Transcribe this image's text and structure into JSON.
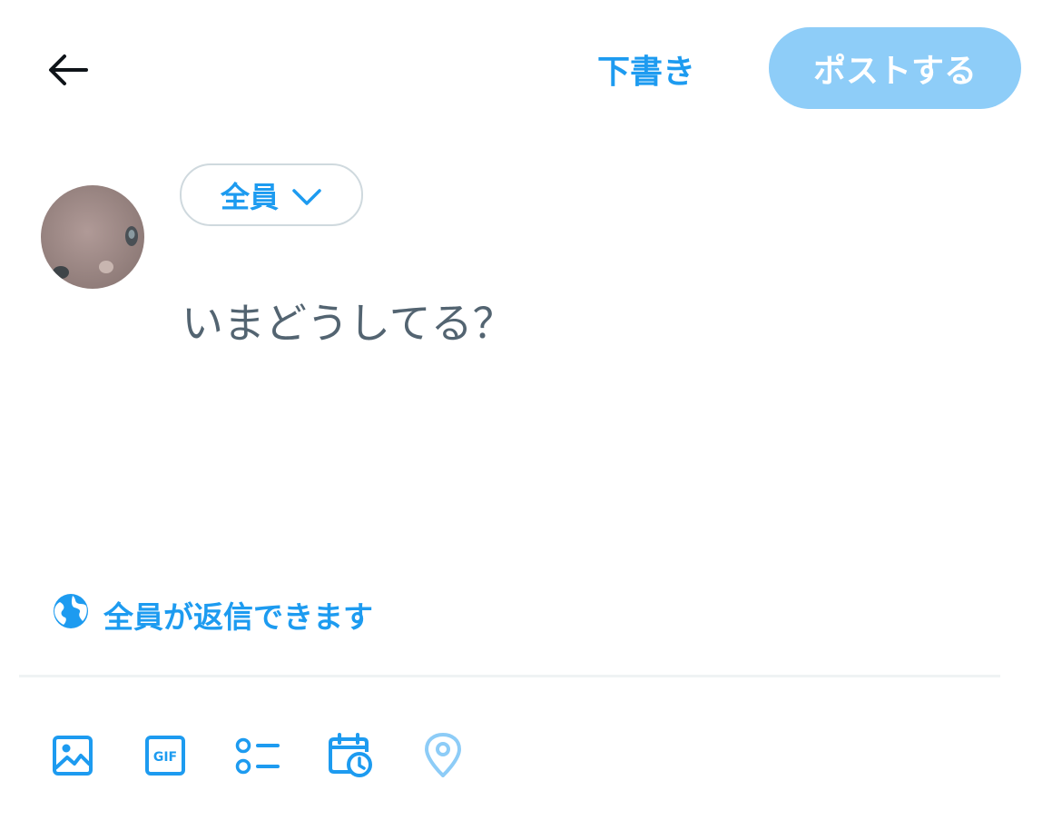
{
  "header": {
    "draft_label": "下書き",
    "post_label": "ポストする"
  },
  "composer": {
    "audience_label": "全員",
    "placeholder": "いまどうしてる？"
  },
  "reply_setting": {
    "label": "全員が返信できます"
  },
  "colors": {
    "accent": "#1d9bf0",
    "post_disabled_bg": "#8ecdf8",
    "placeholder": "#536471",
    "divider": "#eff3f4"
  },
  "toolbar": {
    "icons": [
      "image-icon",
      "gif-icon",
      "poll-icon",
      "schedule-icon",
      "location-icon"
    ],
    "gif_glyph": "GIF"
  }
}
